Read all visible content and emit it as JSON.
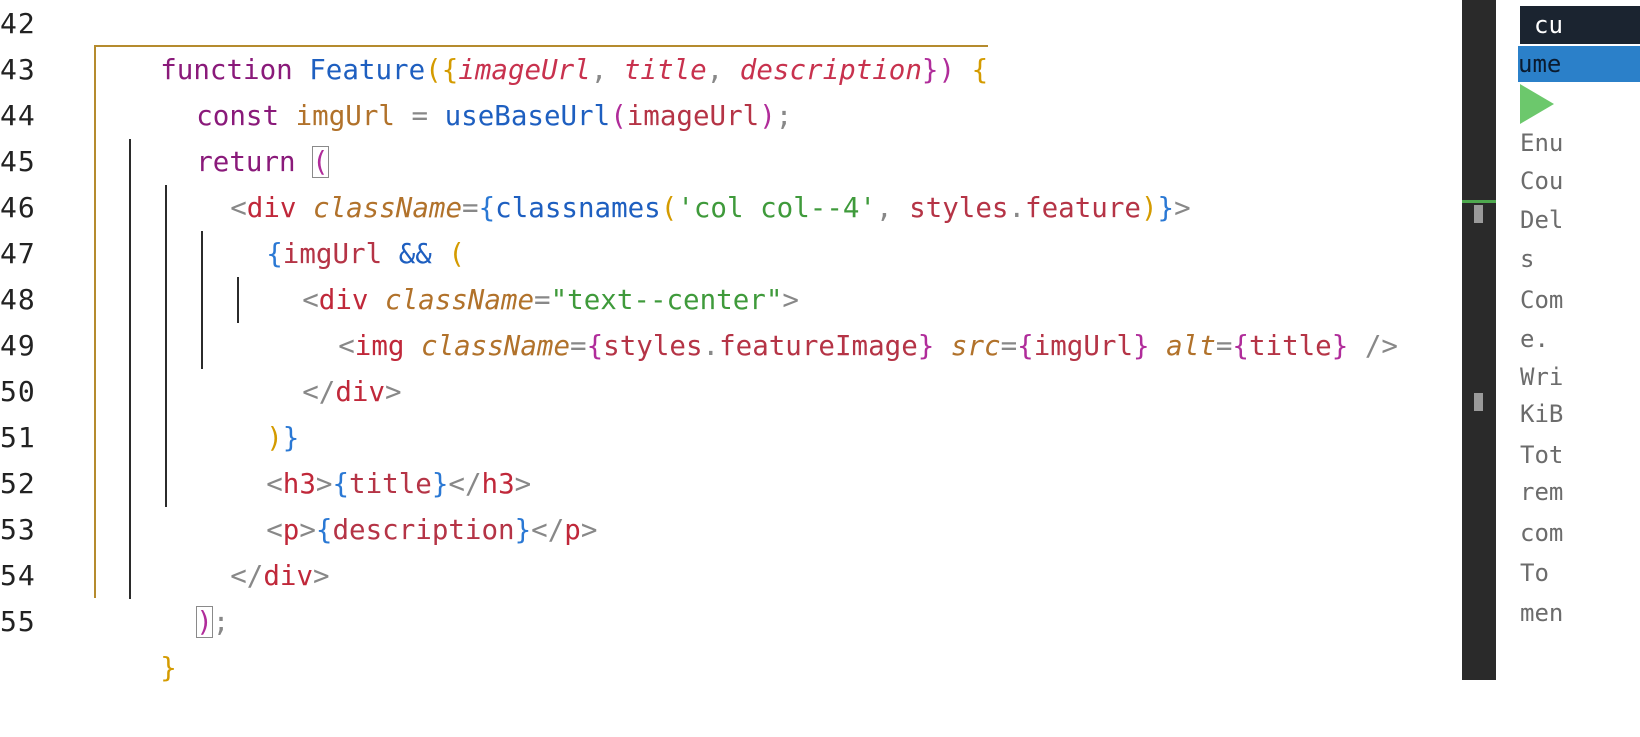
{
  "editor": {
    "line_numbers": [
      "42",
      "43",
      "44",
      "45",
      "46",
      "47",
      "48",
      "49",
      "50",
      "51",
      "52",
      "53",
      "54",
      "55"
    ],
    "lines": {
      "l42": {
        "kw_function": "function",
        "fn_name": "Feature",
        "open": "({",
        "p1": "imageUrl",
        "c1": ", ",
        "p2": "title",
        "c2": ", ",
        "p3": "description",
        "close": "})",
        "brace": " {"
      },
      "l43": {
        "kw_const": "const",
        "var": " imgUrl",
        "eq": " = ",
        "fn": "useBaseUrl",
        "open": "(",
        "arg": "imageUrl",
        "close": ")",
        "semi": ";"
      },
      "l44": {
        "kw_return": "return",
        "space": " ",
        "paren": "("
      },
      "l45": {
        "lt": "<",
        "tag": "div",
        "attr": " className",
        "eq": "=",
        "b_open": "{",
        "fn": "classnames",
        "p_open": "(",
        "str": "'col col--4'",
        "comma": ", ",
        "obj": "styles",
        "dot": ".",
        "prop": "feature",
        "p_close": ")",
        "b_close": "}",
        "gt": ">"
      },
      "l46": {
        "b_open": "{",
        "var": "imgUrl",
        "and": " && ",
        "p_open": "("
      },
      "l47": {
        "lt": "<",
        "tag": "div",
        "attr": " className",
        "eq": "=",
        "str": "\"text--center\"",
        "gt": ">"
      },
      "l48": {
        "lt": "<",
        "tag": "img",
        "attr1": " className",
        "eq1": "=",
        "b1o": "{",
        "obj": "styles",
        "dot": ".",
        "prop": "featureImage",
        "b1c": "}",
        "attr2": " src",
        "eq2": "=",
        "b2o": "{",
        "v2": "imgUrl",
        "b2c": "}",
        "attr3": " alt",
        "eq3": "=",
        "b3o": "{",
        "v3": "title",
        "b3c": "}",
        "end": " />"
      },
      "l49": {
        "lt": "</",
        "tag": "div",
        "gt": ">"
      },
      "l50": {
        "p_close": ")",
        "b_close": "}"
      },
      "l51": {
        "lt": "<",
        "tag": "h3",
        "gt": ">",
        "b_open": "{",
        "var": "title",
        "b_close": "}",
        "lt2": "</",
        "tag2": "h3",
        "gt2": ">"
      },
      "l52": {
        "lt": "<",
        "tag": "p",
        "gt": ">",
        "b_open": "{",
        "var": "description",
        "b_close": "}",
        "lt2": "</",
        "tag2": "p",
        "gt2": ">"
      },
      "l53": {
        "lt": "</",
        "tag": "div",
        "gt": ">"
      },
      "l54": {
        "paren": ")",
        "semi": ";"
      },
      "l55": {
        "brace": "}"
      }
    }
  },
  "panel": {
    "header": "cu",
    "selected": "ume",
    "lines": [
      "Enu",
      "Cou",
      "Del",
      "s",
      "Com",
      "e.",
      "Wri",
      "KiB",
      "Tot",
      "rem",
      "com",
      "To",
      "men"
    ]
  },
  "colors": {
    "keyword": "#8a1a7a",
    "function": "#1e5fc0",
    "parameter": "#c8324e",
    "string": "#3f9a3b",
    "tag": "#c0283a",
    "attribute": "#b1722b",
    "bracket_level1": "#d49b00",
    "bracket_level2": "#b02c9a",
    "bracket_level3": "#2a78d4",
    "panel_header_bg": "#1b2430",
    "panel_selected_bg": "#2b80c9",
    "panel_arrow": "#6cc86c"
  }
}
